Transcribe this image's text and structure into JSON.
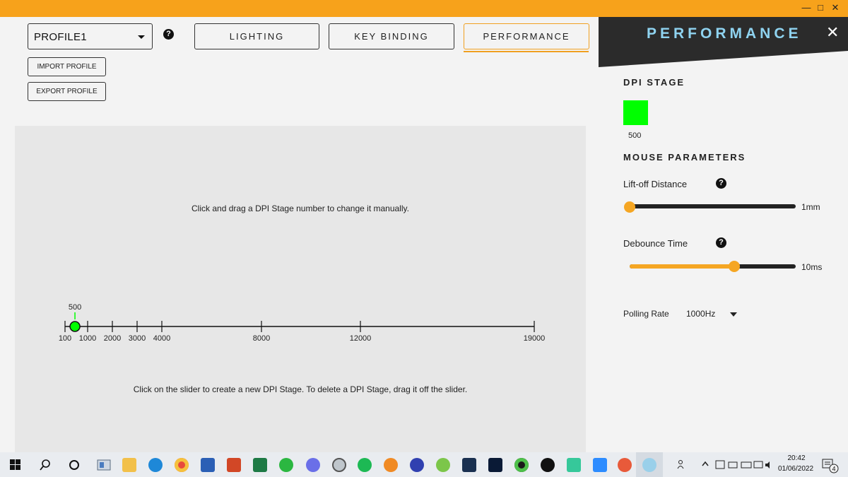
{
  "window": {
    "minimize_glyph": "—",
    "maximize_glyph": "□",
    "close_glyph": "✕"
  },
  "header": {
    "profile_value": "PROFILE1",
    "help_glyph": "?",
    "tabs": [
      {
        "label": "LIGHTING",
        "active": false
      },
      {
        "label": "KEY BINDING",
        "active": false
      },
      {
        "label": "PERFORMANCE",
        "active": true
      }
    ],
    "import_label": "IMPORT PROFILE",
    "export_label": "EXPORT PROFILE"
  },
  "dpi_panel": {
    "instruction_top": "Click and drag a DPI Stage number to change it manually.",
    "instruction_bottom": "Click on the slider to create a new DPI Stage. To delete a DPI Stage, drag it off the slider.",
    "stage_value": "500",
    "stage_color": "#00ff00",
    "slider_min": 100,
    "slider_max": 19000,
    "ticks": [
      "100",
      "1000",
      "2000",
      "3000",
      "4000",
      "8000",
      "12000",
      "19000"
    ]
  },
  "sidepanel": {
    "title": "PERFORMANCE",
    "close_glyph": "✕",
    "dpi_stage_heading": "DPI STAGE",
    "dpi_stage_value": "500",
    "mouse_params_heading": "MOUSE PARAMETERS",
    "liftoff_label": "Lift-off Distance",
    "liftoff_value": "1mm",
    "liftoff_fraction": 0.0,
    "debounce_label": "Debounce Time",
    "debounce_value": "10ms",
    "debounce_fraction": 0.63,
    "polling_label": "Polling Rate",
    "polling_value": "1000Hz",
    "accent_color": "#f5a623",
    "title_color": "#8fd3f0"
  },
  "taskbar": {
    "time": "20:42",
    "date": "01/06/2022",
    "notification_count": "4",
    "icons": [
      "windows-start-icon",
      "search-icon",
      "cortana-icon",
      "task-view-icon",
      "file-explorer-icon",
      "edge-icon",
      "chrome-icon",
      "word-icon",
      "powerpoint-icon",
      "excel-icon",
      "whatsapp-icon",
      "discord-icon",
      "app-icon",
      "spotify-icon",
      "fl-studio-icon",
      "audio-app-icon",
      "app2-icon",
      "vegas-icon",
      "photoshop-icon",
      "vpn-icon",
      "g-hub-icon",
      "game-app-icon",
      "zoom-icon",
      "app3-icon",
      "active-app-icon"
    ]
  }
}
